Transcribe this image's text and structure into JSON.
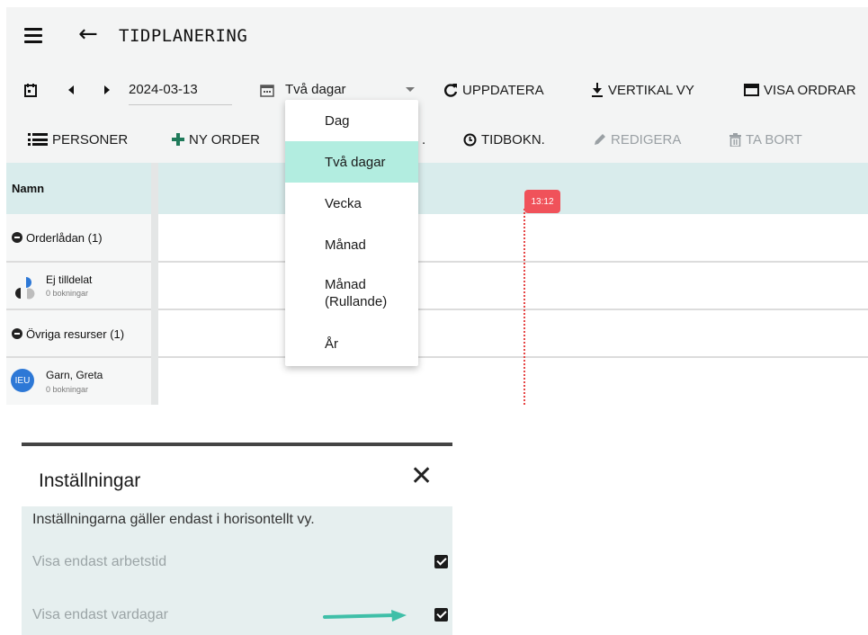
{
  "header": {
    "title": "TIDPLANERING"
  },
  "toolbar1": {
    "date": "2024-03-13",
    "view_value": "Två dagar",
    "refresh_label": "UPPDATERA",
    "vertical_label": "VERTIKAL VY",
    "show_orders_label": "VISA ORDRAR"
  },
  "toolbar2": {
    "persons_label": "PERSONER",
    "new_order_label": "NY ORDER",
    "partial_dot": ".",
    "time_booking_label": "TIDBOKN.",
    "edit_label": "REDIGERA",
    "delete_label": "TA BORT"
  },
  "grid": {
    "name_header": "Namn",
    "now_time": "13:12",
    "rows": [
      {
        "label": "Orderlådan (1)"
      },
      {
        "label": "Ej tilldelat",
        "sub": "0 bokningar"
      },
      {
        "label": "Övriga resurser (1)"
      },
      {
        "label": "Garn, Greta",
        "sub": "0 bokningar",
        "avatar": "IEU"
      }
    ]
  },
  "view_dropdown": {
    "options": [
      "Dag",
      "Två dagar",
      "Vecka",
      "Månad",
      "Månad (Rullande)",
      "År"
    ],
    "selected": "Två dagar"
  },
  "settings": {
    "title": "Inställningar",
    "close_symbol": "✕",
    "info": "Inställningarna gäller endast i horisontellt vy.",
    "options": [
      {
        "label": "Visa endast arbetstid",
        "checked": true
      },
      {
        "label": "Visa endast vardagar",
        "checked": true
      }
    ]
  },
  "colors": {
    "accent": "#2fb59a",
    "selected_option": "#b2ede0",
    "now_marker": "#f0525a",
    "header_band": "#d9ecec",
    "avatar": "#2d78d6",
    "annotation_arrow": "#3fbfa8"
  }
}
